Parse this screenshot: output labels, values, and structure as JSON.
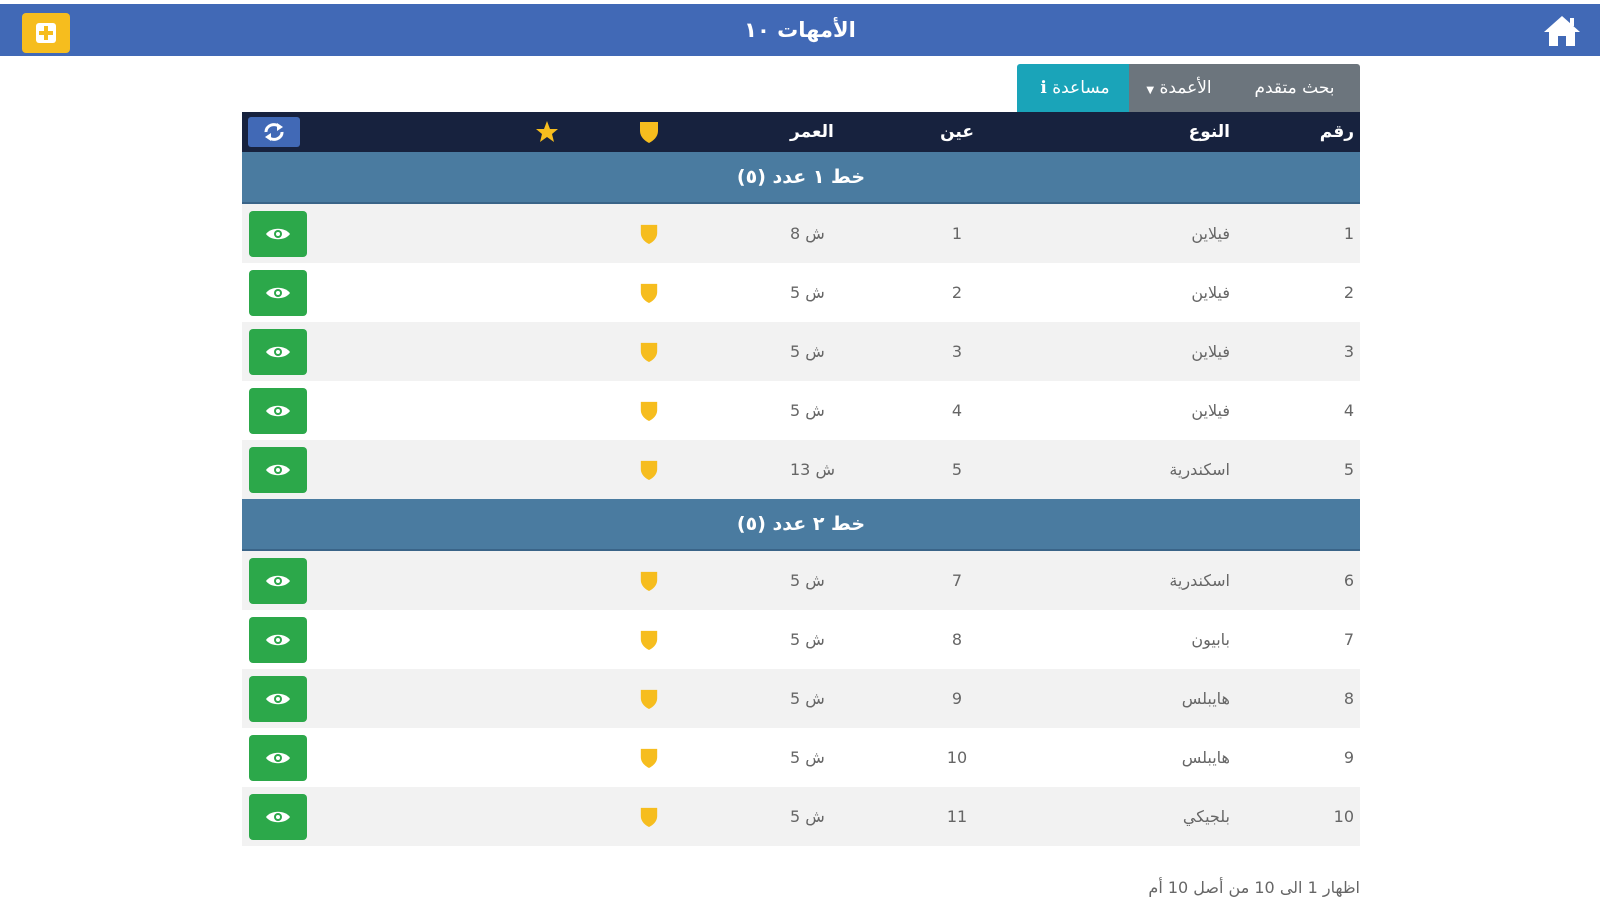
{
  "header": {
    "title": "الأمهات ١٠",
    "add_icon": "plus-square-icon",
    "home_icon": "home-icon",
    "bg_color": "#4169b6",
    "add_color": "#f6bd1e"
  },
  "toolbar": {
    "help_label": "مساعدة",
    "columns_label": "الأعمدة",
    "advanced_search_label": "بحث متقدم"
  },
  "table": {
    "headers": {
      "number": "رقم",
      "type": "النوع",
      "eye": "عين",
      "age": "العمر"
    },
    "groups": [
      {
        "label": "خط ١ عدد (٥)",
        "rows": [
          {
            "number": "1",
            "type": "فيلاين",
            "eye": "1",
            "age": "8 ش"
          },
          {
            "number": "2",
            "type": "فيلاين",
            "eye": "2",
            "age": "5 ش"
          },
          {
            "number": "3",
            "type": "فيلاين",
            "eye": "3",
            "age": "5 ش"
          },
          {
            "number": "4",
            "type": "فيلاين",
            "eye": "4",
            "age": "5 ش"
          },
          {
            "number": "5",
            "type": "اسكندرية",
            "eye": "5",
            "age": "13 ش"
          }
        ]
      },
      {
        "label": "خط ٢ عدد (٥)",
        "rows": [
          {
            "number": "6",
            "type": "اسكندرية",
            "eye": "7",
            "age": "5 ش"
          },
          {
            "number": "7",
            "type": "بابيون",
            "eye": "8",
            "age": "5 ش"
          },
          {
            "number": "8",
            "type": "هايبلس",
            "eye": "9",
            "age": "5 ش"
          },
          {
            "number": "9",
            "type": "هايبلس",
            "eye": "10",
            "age": "5 ش"
          },
          {
            "number": "10",
            "type": "بلجيكي",
            "eye": "11",
            "age": "5 ش"
          }
        ]
      }
    ]
  },
  "footer": {
    "info": "اظهار 1 الى 10 من أصل 10 أم"
  },
  "colors": {
    "table_header": "#17223e",
    "group_row": "#4a7ba0",
    "view_button": "#2ca84a",
    "shield": "#f6bd1e",
    "help_button": "#1aa4b9"
  }
}
